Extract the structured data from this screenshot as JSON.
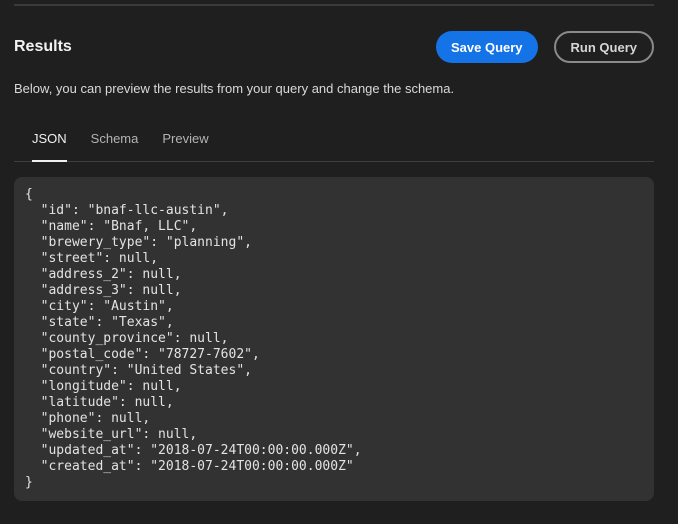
{
  "header": {
    "title": "Results",
    "save_label": "Save Query",
    "run_label": "Run Query"
  },
  "description": "Below, you can preview the results from your query and change the schema.",
  "tabs": [
    {
      "label": "JSON",
      "selected": true
    },
    {
      "label": "Schema",
      "selected": false
    },
    {
      "label": "Preview",
      "selected": false
    }
  ],
  "result_json": "{\n  \"id\": \"bnaf-llc-austin\",\n  \"name\": \"Bnaf, LLC\",\n  \"brewery_type\": \"planning\",\n  \"street\": null,\n  \"address_2\": null,\n  \"address_3\": null,\n  \"city\": \"Austin\",\n  \"state\": \"Texas\",\n  \"county_province\": null,\n  \"postal_code\": \"78727-7602\",\n  \"country\": \"United States\",\n  \"longitude\": null,\n  \"latitude\": null,\n  \"phone\": null,\n  \"website_url\": null,\n  \"updated_at\": \"2018-07-24T00:00:00.000Z\",\n  \"created_at\": \"2018-07-24T00:00:00.000Z\"\n}",
  "colors": {
    "background": "#1f1f20",
    "primary_button": "#1473e6",
    "code_panel": "#323233"
  }
}
